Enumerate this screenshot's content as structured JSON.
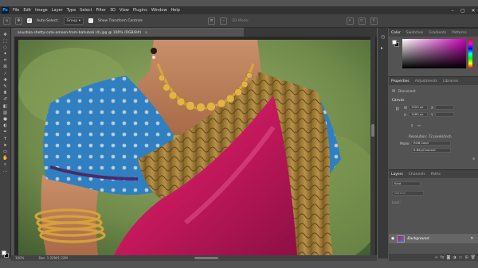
{
  "app": {
    "logo": "Ps",
    "menu": [
      "File",
      "Edit",
      "Image",
      "Layer",
      "Type",
      "Select",
      "Filter",
      "3D",
      "View",
      "Plugins",
      "Window",
      "Help"
    ],
    "window_controls": {
      "minimize": "–",
      "maximize": "▢",
      "close": "✕"
    }
  },
  "options": {
    "auto_select_label": "Auto-Select:",
    "auto_select_value": "Group",
    "transform_label": "Show Transform Controls",
    "mode_3d": "3D Mode:"
  },
  "document": {
    "tab_title": "anushka shetty-cute-amoon-from-bahubali (4).jpg @ 100% (RGB/8#)",
    "close": "×"
  },
  "status": {
    "zoom": "100%",
    "doc_size": "Doc: 1.22M/1.22M"
  },
  "panels": {
    "color_tabs": [
      "Color",
      "Swatches",
      "Gradients",
      "Patterns"
    ],
    "props_tabs": [
      "Properties",
      "Adjustments",
      "Libraries"
    ],
    "document_label": "Document",
    "canvas_label": "Canvas",
    "width_label": "W",
    "width_value": "1920 px",
    "height_label": "H",
    "height_value": "1080 px",
    "x_label": "X",
    "y_label": "Y",
    "resolution": "Resolution: 72 pixels/inch",
    "mode_label": "Mode",
    "mode_value": "RGB Color",
    "depth_value": "8 Bits/Channel",
    "layers_tabs": [
      "Layers",
      "Channels",
      "Paths"
    ],
    "kind": "Kind",
    "normal": "Normal",
    "lock": "Lock:",
    "layer_name": "Background"
  },
  "colors": {
    "ui_dark": "#323232",
    "ui_mid": "#424242",
    "ui_panel": "#535353",
    "saree_pink": "#c2185b",
    "blouse_blue": "#2f7fc1",
    "gold": "#c9a24a"
  },
  "icons": [
    "move-icon",
    "marquee-icon",
    "lasso-icon",
    "magic-wand-icon",
    "crop-icon",
    "eyedropper-icon",
    "healing-icon",
    "brush-icon",
    "stamp-icon",
    "history-brush-icon",
    "eraser-icon",
    "gradient-icon",
    "blur-icon",
    "dodge-icon",
    "pen-icon",
    "type-icon",
    "path-select-icon",
    "shape-icon",
    "hand-icon",
    "zoom-icon"
  ]
}
